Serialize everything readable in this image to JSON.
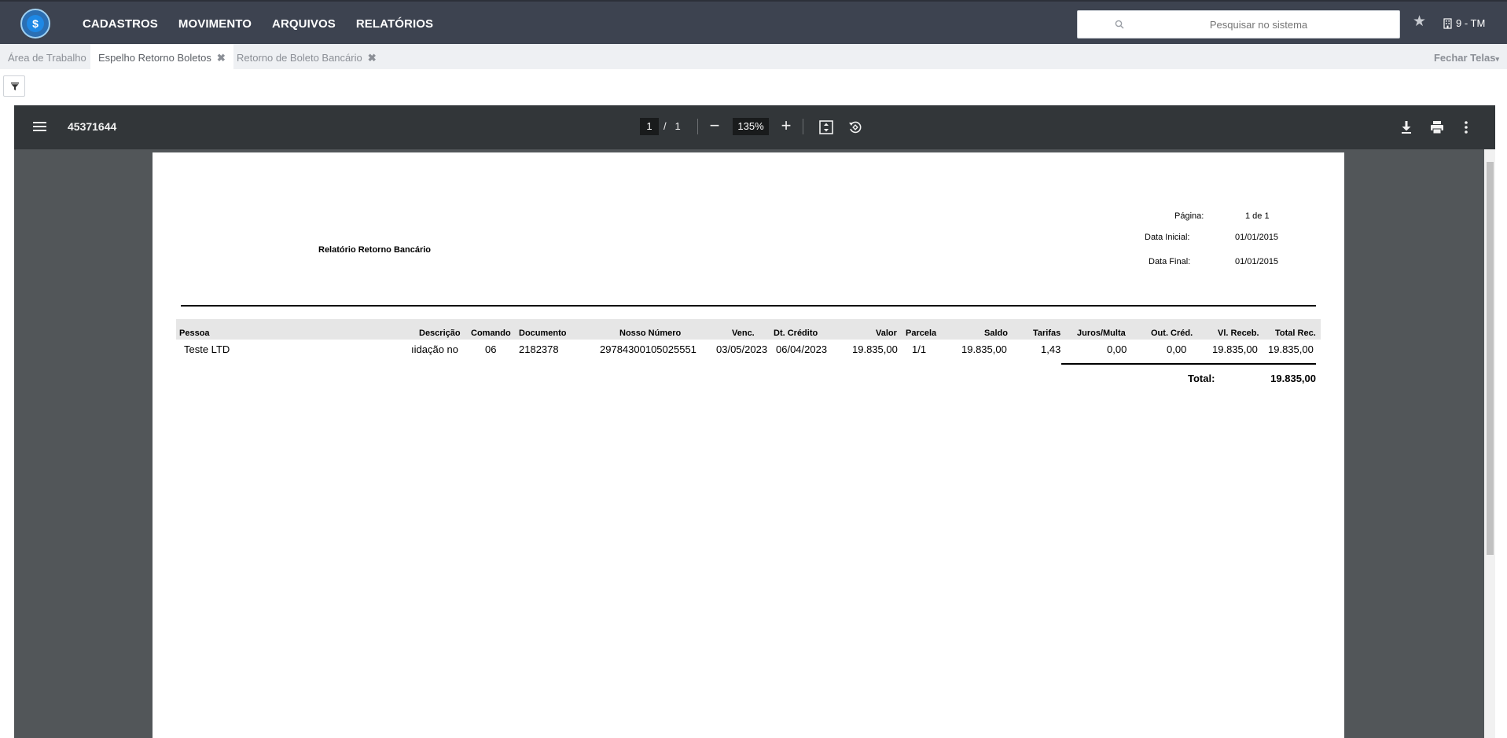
{
  "header": {
    "logo_symbol": "$",
    "menu": [
      "CADASTROS",
      "MOVIMENTO",
      "ARQUIVOS",
      "RELATÓRIOS"
    ],
    "search_placeholder": "Pesquisar no sistema",
    "company": "9 - TM"
  },
  "tabs": [
    {
      "label": "Área de Trabalho",
      "active": false,
      "closable": false
    },
    {
      "label": "Espelho Retorno Boletos",
      "active": true,
      "closable": true
    },
    {
      "label": "Retorno de Boleto Bancário",
      "active": false,
      "closable": true
    }
  ],
  "close_screens_label": "Fechar Telas",
  "viewer": {
    "doc_title": "45371644",
    "current_page": "1",
    "page_separator": "/",
    "total_pages": "1",
    "zoom": "135%"
  },
  "report": {
    "title": "Relatório Retorno Bancário",
    "meta": [
      {
        "label": "Página:",
        "value": "1 de 1"
      },
      {
        "label": "Data Inicial:",
        "value": "01/01/2015"
      },
      {
        "label": "Data Final:",
        "value": "01/01/2015"
      }
    ],
    "columns": [
      "Pessoa",
      "Descrição",
      "Comando",
      "Documento",
      "Nosso Número",
      "Venc.",
      "Dt. Crédito",
      "Valor",
      "Parcela",
      "Saldo",
      "Tarifas",
      "Juros/Multa",
      "Out. Créd.",
      "Vl. Receb.",
      "Total Rec."
    ],
    "row": [
      "Teste LTD",
      "ıidação nor",
      "06",
      "2182378",
      "29784300105025551",
      "03/05/2023",
      "06/04/2023",
      "19.835,00",
      "1/1",
      "19.835,00",
      "1,43",
      "0,00",
      "0,00",
      "19.835,00",
      "19.835,00"
    ],
    "total_label": "Total:",
    "total_value": "19.835,00"
  },
  "colors": {
    "topbar": "#3d4350",
    "viewer_toolbar": "#323639",
    "viewer_bg": "#525659",
    "tabsbar": "#eef0f3"
  }
}
